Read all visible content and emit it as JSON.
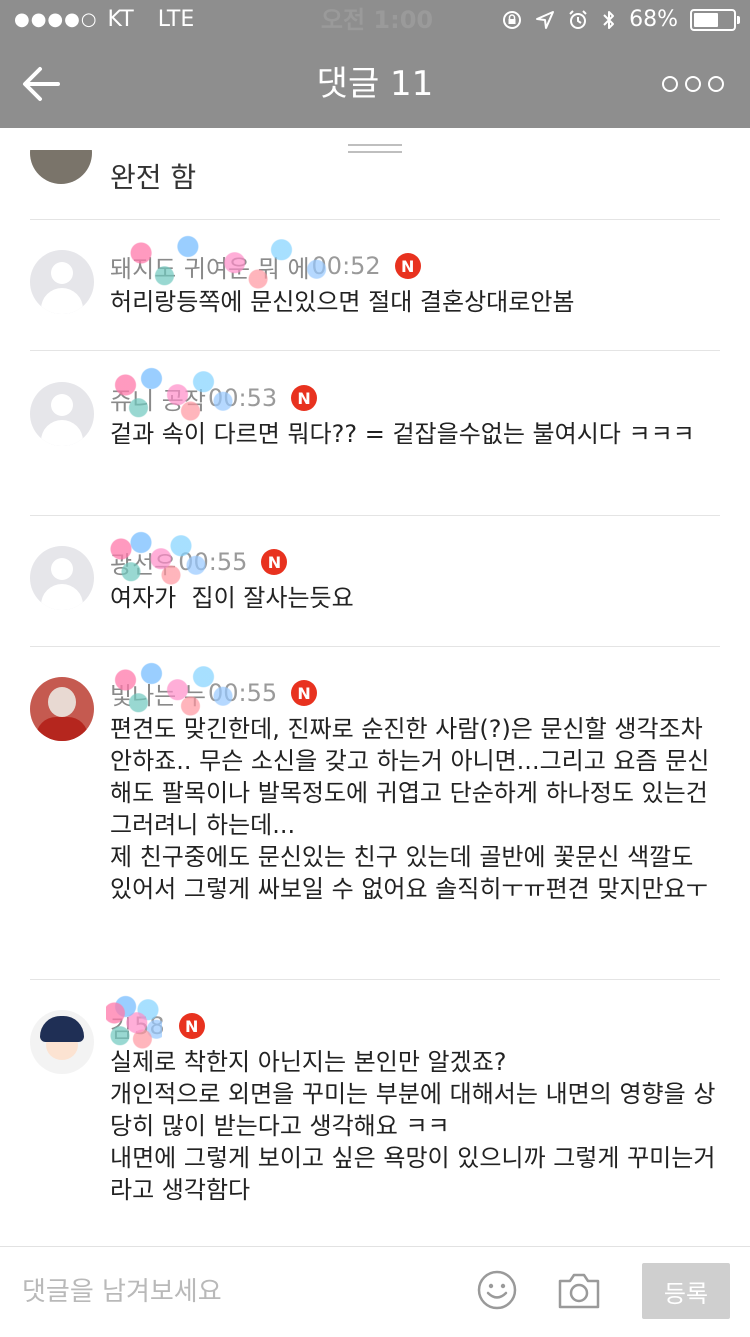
{
  "status_bar": {
    "signal_dots": "●●●●○",
    "carrier": "KT",
    "network": "LTE",
    "time": "오전 1:00",
    "battery_text": "68%",
    "battery_level": 0.68
  },
  "header": {
    "title": "댓글 11",
    "back_icon": "back-arrow-icon",
    "more_icon": "more-dots-icon",
    "color": "#8e8e8e"
  },
  "previous_comment": {
    "snippet": "완전 함"
  },
  "comments": [
    {
      "author": "돼지도 귀여운 뭐 에",
      "time": "00:52",
      "badge": "N",
      "text": "허리랑등쪽에 문신있으면 절대 결혼상대로안봄"
    },
    {
      "author": "쥬니 공작",
      "time": "00:53",
      "badge": "N",
      "text": "겉과 속이 다르면 뭐다?? = 겉잡을수없는 불여시다 ㅋㅋㅋ"
    },
    {
      "author": "광선우",
      "time": "00:55",
      "badge": "N",
      "text": "여자가  집이 잘사는듯요"
    },
    {
      "author": "빛나는 누",
      "time": "00:55",
      "badge": "N",
      "text": "편견도 맞긴한데, 진짜로 순진한 사람(?)은 문신할 생각조차 안하죠.. 무슨 소신을 갖고 하는거 아니면...그리고 요즘 문신해도 팔목이나 발목정도에 귀엽고 단순하게 하나정도 있는건 그러려니 하는데...\n제 친구중에도 문신있는 친구 있는데 골반에 꽃문신 색깔도 있어서 그렇게 싸보일 수 없어요 솔직히ㅜㅠ편견 맞지만요ㅜ"
    },
    {
      "author": "김 ",
      "time": "58",
      "badge": "N",
      "text": "실제로 착한지 아닌지는 본인만 알겠죠?\n개인적으로 외면을 꾸미는 부분에 대해서는 내면의 영향을 상당히 많이 받는다고 생각해요 ㅋㅋ\n내면에 그렇게 보이고 싶은 욕망이 있으니까 그렇게 꾸미는거라고 생각함다"
    }
  ],
  "input_bar": {
    "placeholder": "댓글을 남겨보세요",
    "emoji_icon": "smile-icon",
    "camera_icon": "camera-icon",
    "submit_label": "등록"
  }
}
